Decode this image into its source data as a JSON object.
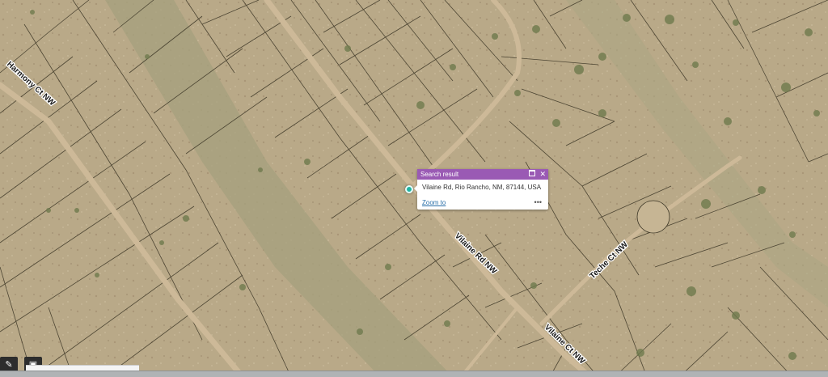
{
  "map": {
    "basemap": "satellite imagery",
    "colors": {
      "ground": "#b9a988",
      "parcel_line": "#3a3424",
      "road": "#cdb998",
      "popup_header": "#9a5ab4",
      "pin": "#20b3a3"
    },
    "road_labels": [
      {
        "name": "Harmony Ct NW"
      },
      {
        "name": "Vilaine Rd NW"
      },
      {
        "name": "Vilaine Ct NW"
      },
      {
        "name": "Teche Ct NW"
      }
    ]
  },
  "popup": {
    "title": "Search result",
    "address": "Vilaine Rd, Rio Rancho, NM, 87144, USA",
    "zoom_label": "Zoom to",
    "more_icon": "more-dots-icon",
    "maximize_icon": "maximize-icon",
    "close_icon": "close-icon"
  },
  "toolbar": {
    "left_tool_icon": "edit-pencil-icon",
    "second_tool_icon": "widget-icon"
  }
}
